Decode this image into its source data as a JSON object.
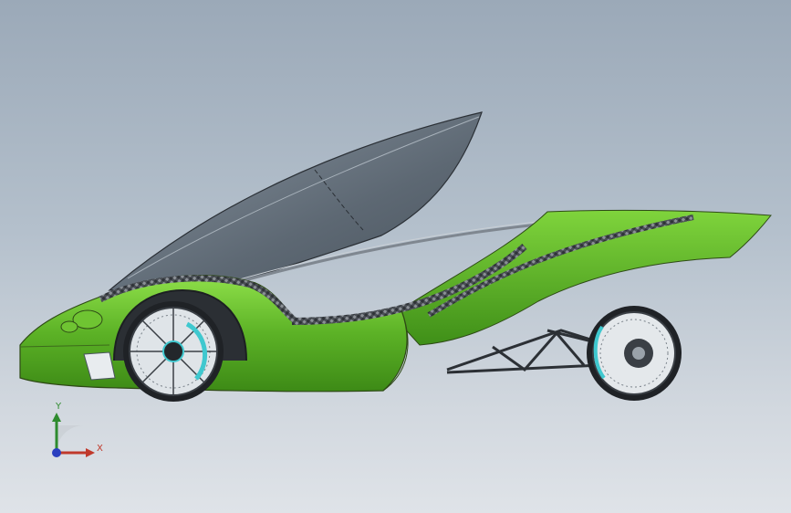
{
  "viewport": {
    "model": "streamlined-three-wheel-vehicle",
    "body_color": "#5fb52a",
    "canopy_color": "#6f7a85",
    "background_top": "#9ba9b8",
    "background_bottom": "#dfe3e8"
  },
  "triad": {
    "y_label": "Y",
    "x_label": "X",
    "y_color": "#2e8b2e",
    "x_color": "#c0392b",
    "origin_color": "#2a3fbf"
  }
}
